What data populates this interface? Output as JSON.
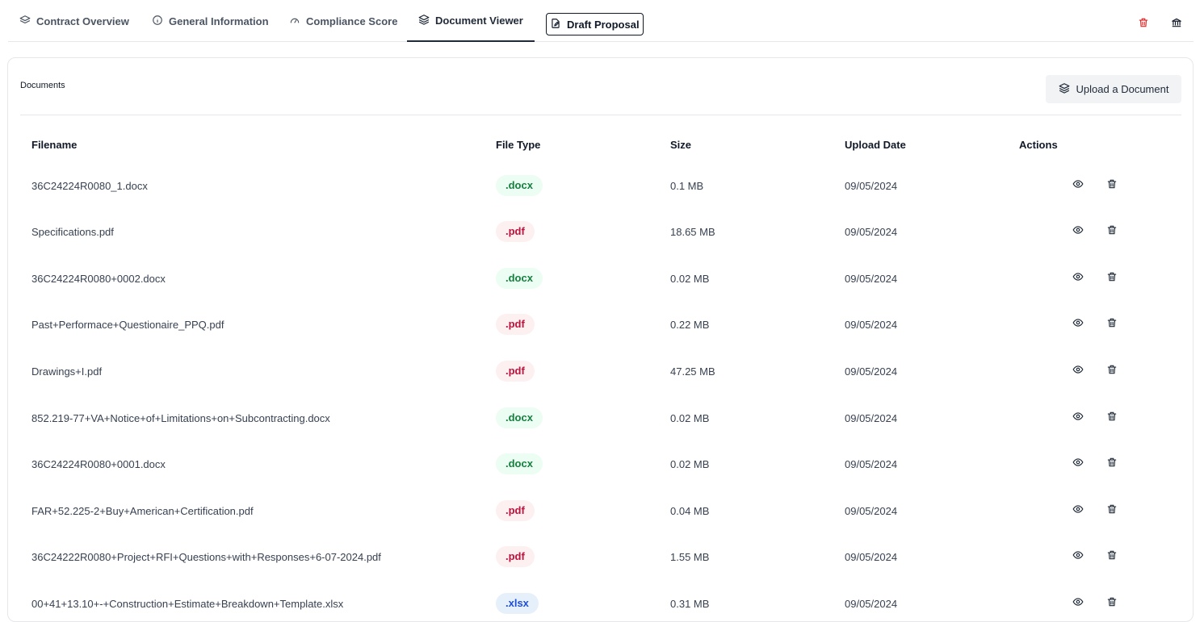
{
  "tabs": [
    {
      "label": "Contract Overview",
      "icon": "layers-icon"
    },
    {
      "label": "General Information",
      "icon": "info-icon"
    },
    {
      "label": "Compliance Score",
      "icon": "gauge-icon"
    },
    {
      "label": "Document Viewer",
      "icon": "layers-icon",
      "active": true
    },
    {
      "label": "Draft Proposal",
      "icon": "edit-document-icon"
    }
  ],
  "header_actions": [
    {
      "icon": "trash-icon",
      "color": "#dc2626"
    },
    {
      "icon": "bank-icon",
      "color": "#111827"
    }
  ],
  "documents": {
    "title": "Documents",
    "upload_label": "Upload a Document",
    "upload_icon": "layers-icon",
    "columns": [
      "Filename",
      "File Type",
      "Size",
      "Upload Date",
      "Actions"
    ],
    "rows": [
      {
        "filename": "36C24224R0080_1.docx",
        "type": ".docx",
        "size": "0.1 MB",
        "date": "09/05/2024"
      },
      {
        "filename": "Specifications.pdf",
        "type": ".pdf",
        "size": "18.65 MB",
        "date": "09/05/2024"
      },
      {
        "filename": "36C24224R0080+0002.docx",
        "type": ".docx",
        "size": "0.02 MB",
        "date": "09/05/2024"
      },
      {
        "filename": "Past+Performace+Questionaire_PPQ.pdf",
        "type": ".pdf",
        "size": "0.22 MB",
        "date": "09/05/2024"
      },
      {
        "filename": "Drawings+I.pdf",
        "type": ".pdf",
        "size": "47.25 MB",
        "date": "09/05/2024"
      },
      {
        "filename": "852.219-77+VA+Notice+of+Limitations+on+Subcontracting.docx",
        "type": ".docx",
        "size": "0.02 MB",
        "date": "09/05/2024"
      },
      {
        "filename": "36C24224R0080+0001.docx",
        "type": ".docx",
        "size": "0.02 MB",
        "date": "09/05/2024"
      },
      {
        "filename": "FAR+52.225-2+Buy+American+Certification.pdf",
        "type": ".pdf",
        "size": "0.04 MB",
        "date": "09/05/2024"
      },
      {
        "filename": "36C24222R0080+Project+RFI+Questions+with+Responses+6-07-2024.pdf",
        "type": ".pdf",
        "size": "1.55 MB",
        "date": "09/05/2024"
      },
      {
        "filename": "00+41+13.10+-+Construction+Estimate+Breakdown+Template.xlsx",
        "type": ".xlsx",
        "size": "0.31 MB",
        "date": "09/05/2024"
      }
    ],
    "row_actions": [
      {
        "icon": "eye-icon"
      },
      {
        "icon": "trash-icon"
      }
    ]
  }
}
